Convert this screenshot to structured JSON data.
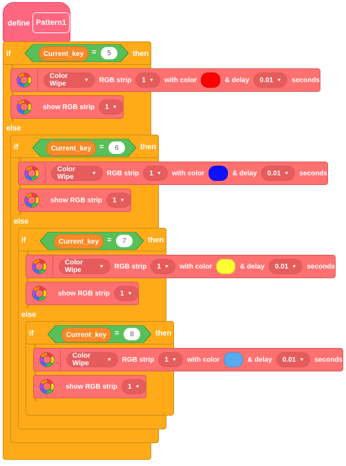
{
  "define": {
    "label": "define",
    "proc": "Pattern1"
  },
  "kw": {
    "if": "if",
    "then": "then",
    "else": "else"
  },
  "cond": {
    "var": "Current_key",
    "op": "="
  },
  "levels": [
    {
      "key": "5",
      "wipe": {
        "effect": "Color Wipe",
        "strip_label": "RGB strip",
        "strip": "1",
        "with_label": "with color",
        "color": "#FF0000",
        "delay_label": "& delay",
        "delay": "0.01",
        "seconds": "seconds"
      },
      "show": {
        "label": "show RGB strip",
        "strip": "1"
      }
    },
    {
      "key": "6",
      "wipe": {
        "effect": "Color Wipe",
        "strip_label": "RGB strip",
        "strip": "1",
        "with_label": "with color",
        "color": "#1010FF",
        "delay_label": "& delay",
        "delay": "0.01",
        "seconds": "seconds"
      },
      "show": {
        "label": "show RGB strip",
        "strip": "1"
      }
    },
    {
      "key": "7",
      "wipe": {
        "effect": "Color Wipe",
        "strip_label": "RGB strip",
        "strip": "1",
        "with_label": "with color",
        "color": "#FFFF33",
        "delay_label": "& delay",
        "delay": "0.01",
        "seconds": "seconds"
      },
      "show": {
        "label": "show RGB strip",
        "strip": "1"
      }
    },
    {
      "key": "8",
      "wipe": {
        "effect": "Color Wipe",
        "strip_label": "RGB strip",
        "strip": "1",
        "with_label": "with color",
        "color": "#5AAAF0",
        "delay_label": "& delay",
        "delay": "0.01",
        "seconds": "seconds"
      },
      "show": {
        "label": "show RGB strip",
        "strip": "1"
      }
    }
  ],
  "colors": {
    "control": "#FFAB19",
    "operator": "#59C059",
    "variable": "#F68A26",
    "define": "#FF6680",
    "extension": "#FF7070"
  },
  "icons": {
    "extension": "rgb-ring-icon",
    "dropdown": "caret-down-icon"
  }
}
